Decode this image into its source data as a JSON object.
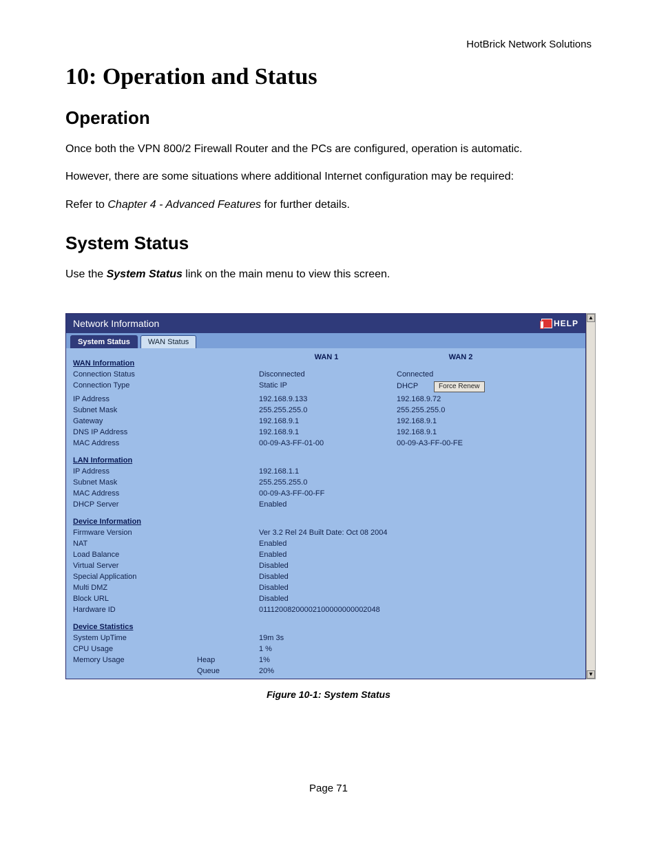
{
  "header_right": "HotBrick Network Solutions",
  "chapter_title": "10: Operation and Status",
  "section1_title": "Operation",
  "para1a": "Once both the VPN 800/2 Firewall Router and the PCs are configured, operation is automatic.",
  "para1b": "However, there are some situations where additional Internet configuration may be required:",
  "para1c_prefix": "Refer to ",
  "para1c_italic": "Chapter 4 - Advanced Features",
  "para1c_suffix": " for further details.",
  "section2_title": "System Status",
  "para2_prefix": "Use the ",
  "para2_bold": "System Status",
  "para2_suffix": " link on the main menu to view this screen.",
  "panel_title": "Network Information",
  "help_label": "HELP",
  "tabs": {
    "active": "System Status",
    "inactive": "WAN Status"
  },
  "wan": {
    "heading": "WAN Information",
    "col1": "WAN 1",
    "col2": "WAN 2",
    "rows": {
      "conn_status_label": "Connection Status",
      "conn_status_w1": "Disconnected",
      "conn_status_w2": "Connected",
      "conn_type_label": "Connection Type",
      "conn_type_w1": "Static IP",
      "conn_type_w2": "DHCP",
      "force_renew_btn": "Force Renew",
      "ip_label": "IP Address",
      "ip_w1": "192.168.9.133",
      "ip_w2": "192.168.9.72",
      "mask_label": "Subnet Mask",
      "mask_w1": "255.255.255.0",
      "mask_w2": "255.255.255.0",
      "gw_label": "Gateway",
      "gw_w1": "192.168.9.1",
      "gw_w2": "192.168.9.1",
      "dns_label": "DNS IP Address",
      "dns_w1": "192.168.9.1",
      "dns_w2": "192.168.9.1",
      "mac_label": "MAC Address",
      "mac_w1": "00-09-A3-FF-01-00",
      "mac_w2": "00-09-A3-FF-00-FE"
    }
  },
  "lan": {
    "heading": "LAN Information",
    "ip_label": "IP Address",
    "ip": "192.168.1.1",
    "mask_label": "Subnet Mask",
    "mask": "255.255.255.0",
    "mac_label": "MAC Address",
    "mac": "00-09-A3-FF-00-FF",
    "dhcp_label": "DHCP Server",
    "dhcp": "Enabled"
  },
  "dev": {
    "heading": "Device Information",
    "fw_label": "Firmware Version",
    "fw": "Ver 3.2 Rel 24 Built Date:  Oct 08 2004",
    "nat_label": "NAT",
    "nat": "Enabled",
    "lb_label": "Load Balance",
    "lb": "Enabled",
    "vs_label": "Virtual Server",
    "vs": "Disabled",
    "sa_label": "Special Application",
    "sa": "Disabled",
    "dmz_label": "Multi DMZ",
    "dmz": "Disabled",
    "burl_label": "Block URL",
    "burl": "Disabled",
    "hwid_label": "Hardware ID",
    "hwid": "01112008200002100000000002048"
  },
  "stat": {
    "heading": "Device Statistics",
    "uptime_label": "System UpTime",
    "uptime": "19m 3s",
    "cpu_label": "CPU Usage",
    "cpu": "1 %",
    "mem_label": "Memory Usage",
    "heap_label": "Heap",
    "heap": "1%",
    "queue_label": "Queue",
    "queue": "20%"
  },
  "figure_caption": "Figure 10-1: System Status",
  "page_number": "Page 71"
}
